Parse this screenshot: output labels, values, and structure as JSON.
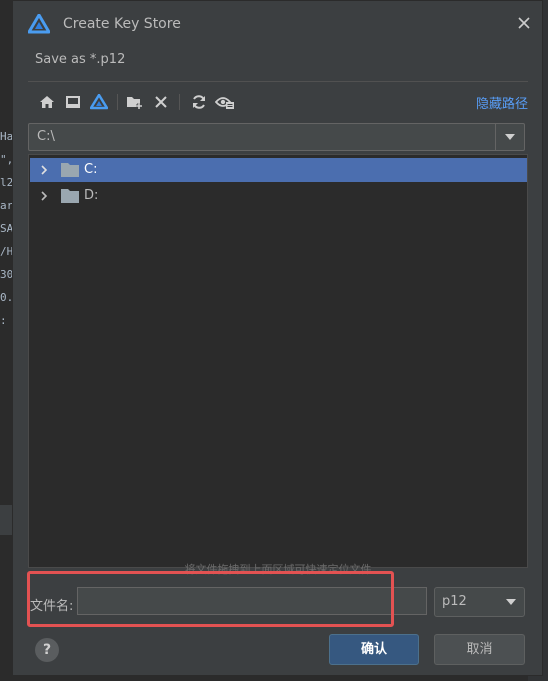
{
  "background": {
    "code_fragments": [
      "Ha",
      "\",",
      "l2",
      "ar",
      "SA",
      "/H",
      "30",
      "",
      "",
      "",
      "",
      "",
      "",
      "0.",
      ":"
    ]
  },
  "dialog": {
    "title": "Create Key Store",
    "subtitle": "Save as *.p12",
    "hide_path_label": "隐藏路径",
    "path_value": "C:\\",
    "tree_items": [
      {
        "label": "C:",
        "selected": true
      },
      {
        "label": "D:",
        "selected": false
      }
    ],
    "drop_hint": "将文件拖拽到上面区域可快速定位文件",
    "filename_label": "文件名:",
    "filename_value": "",
    "extension_value": "p12",
    "ok_label": "确认",
    "cancel_label": "取消",
    "help_label": "?"
  },
  "colors": {
    "accent": "#589df6",
    "selection": "#4b6eaf",
    "highlight_box": "#e35252",
    "primary_button": "#365880"
  }
}
